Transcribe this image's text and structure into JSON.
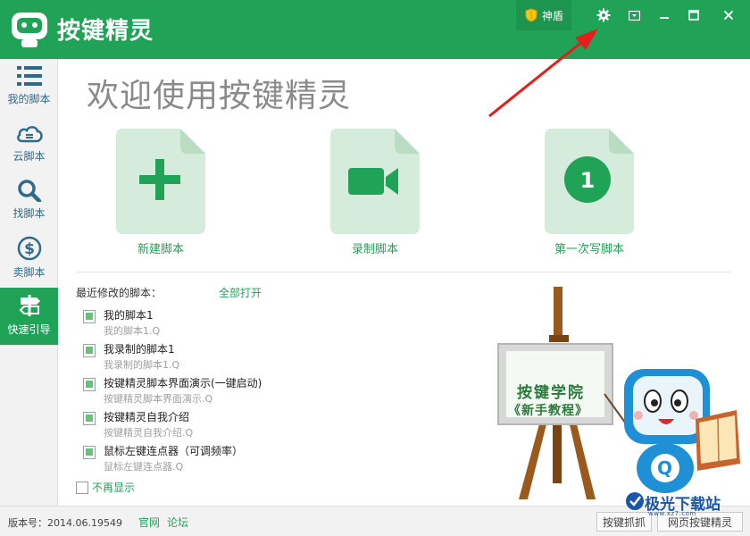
{
  "app": {
    "title": "按键精灵",
    "accent": "#21a357"
  },
  "titlebar": {
    "shield_label": "神盾",
    "controls": [
      "gear-icon",
      "dropdown-icon",
      "minimize-icon",
      "maximize-icon",
      "close-icon"
    ]
  },
  "sidebar": {
    "items": [
      {
        "label": "我的脚本",
        "icon": "list-icon"
      },
      {
        "label": "云脚本",
        "icon": "cloud-icon"
      },
      {
        "label": "找脚本",
        "icon": "search-icon"
      },
      {
        "label": "卖脚本",
        "icon": "dollar-icon"
      },
      {
        "label": "快速引导",
        "icon": "signpost-icon",
        "active": true
      }
    ]
  },
  "main": {
    "welcome": "欢迎使用按键精灵",
    "actions": [
      {
        "label": "新建脚本",
        "icon": "plus-icon"
      },
      {
        "label": "录制脚本",
        "icon": "camera-icon"
      },
      {
        "label": "第一次写脚本",
        "icon": "number-one-icon",
        "number": "1"
      }
    ],
    "recent_title": "最近修改的脚本：",
    "open_all": "全部打开",
    "recent": [
      {
        "name": "我的脚本1",
        "path": "我的脚本1.Q"
      },
      {
        "name": "我录制的脚本1",
        "path": "我录制的脚本1.Q"
      },
      {
        "name": "按键精灵脚本界面演示(一键启动)",
        "path": "按键精灵脚本界面演示.Q"
      },
      {
        "name": "按键精灵自我介绍",
        "path": "按键精灵自我介绍.Q"
      },
      {
        "name": "鼠标左键连点器（可调频率）",
        "path": "鼠标左键连点器.Q"
      }
    ],
    "no_show": "不再显示",
    "board": {
      "line1": "按键学院",
      "line2": "《新手教程》",
      "mascot_letter": "Q"
    }
  },
  "statusbar": {
    "version": "版本号：2014.06.19549",
    "links": [
      "官网",
      "论坛"
    ],
    "buttons": [
      "按键抓抓",
      "网页按键精灵"
    ]
  },
  "watermark": {
    "text": "极光下载站",
    "sub": "www.xz7.com"
  }
}
